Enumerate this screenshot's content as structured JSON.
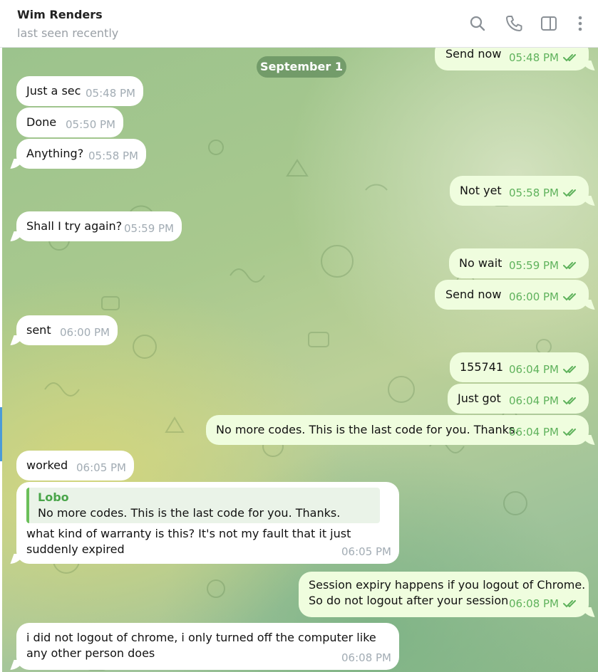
{
  "header": {
    "contact_name": "Wim Renders",
    "status": "last seen recently",
    "icons": [
      "search-icon",
      "phone-icon",
      "sidebar-toggle-icon",
      "more-vertical-icon"
    ]
  },
  "colors": {
    "incoming_bubble": "#ffffff",
    "outgoing_bubble": "#effdde",
    "outgoing_time": "#5fb25c",
    "quote_accent": "#6bbf5a"
  },
  "date_separator": "September 1",
  "messages": [
    {
      "dir": "out",
      "text": "Send now",
      "time": "05:48 PM",
      "read": true
    },
    {
      "dir": "in",
      "text": "Just a sec",
      "time": "05:48 PM"
    },
    {
      "dir": "in",
      "text": "Done",
      "time": "05:50 PM"
    },
    {
      "dir": "in",
      "text": "Anything?",
      "time": "05:58 PM"
    },
    {
      "dir": "out",
      "text": "Not yet",
      "time": "05:58 PM",
      "read": true
    },
    {
      "dir": "in",
      "text": "Shall I try again?",
      "time": "05:59 PM"
    },
    {
      "dir": "out",
      "text": "No wait",
      "time": "05:59 PM",
      "read": true
    },
    {
      "dir": "out",
      "text": "Send now",
      "time": "06:00 PM",
      "read": true
    },
    {
      "dir": "in",
      "text": "sent",
      "time": "06:00 PM"
    },
    {
      "dir": "out",
      "text": "155741",
      "time": "06:04 PM",
      "read": true
    },
    {
      "dir": "out",
      "text": "Just got",
      "time": "06:04 PM",
      "read": true
    },
    {
      "dir": "out",
      "text": "No more codes. This is the last code for you. Thanks.",
      "time": "06:04 PM",
      "read": true
    },
    {
      "dir": "in",
      "text": "worked",
      "time": "06:05 PM"
    },
    {
      "dir": "in",
      "reply_to_name": "Lobo",
      "reply_to_text": "No more codes. This is the last code for you. Thanks.",
      "text": "what kind of warranty is this? It's not my fault that it just suddenly expired",
      "time": "06:05 PM"
    },
    {
      "dir": "out",
      "text_line1": "Session expiry happens if you logout of Chrome.",
      "text_line2": "So do not logout after your session",
      "time": "06:08 PM",
      "read": true
    },
    {
      "dir": "in",
      "text": "i did not logout of chrome, i only turned off the computer like any other person does",
      "time": "06:08 PM"
    }
  ]
}
